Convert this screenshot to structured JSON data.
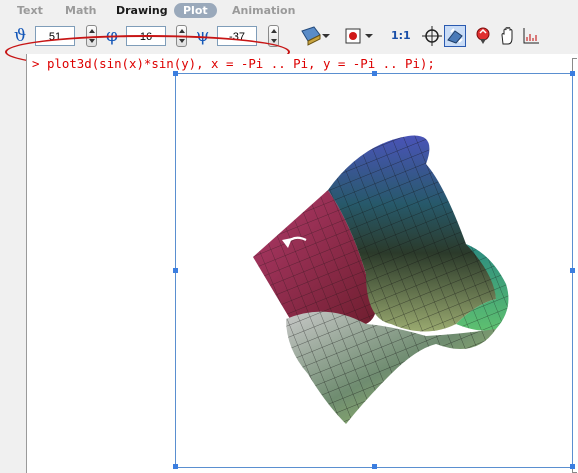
{
  "tabs": [
    {
      "label": "Text"
    },
    {
      "label": "Math"
    },
    {
      "label": "Drawing"
    },
    {
      "label": "Plot"
    },
    {
      "label": "Animation"
    }
  ],
  "toolbar": {
    "theta_symbol": "ϑ",
    "theta_value": "51",
    "phi_symbol": "φ",
    "phi_value": "16",
    "psi_symbol": "ψ",
    "psi_value": "-37",
    "ratio_label": "1:1",
    "icons": [
      "surface-style-icon",
      "color-scheme-icon",
      "ratio-icon",
      "rotate-icon",
      "pan-icon",
      "zoom-icon",
      "scale-icon",
      "axes-icon"
    ]
  },
  "worksheet": {
    "prompt": ">",
    "command": "plot3d(sin(x)*sin(y), x = -Pi .. Pi, y = -Pi .. Pi);"
  }
}
